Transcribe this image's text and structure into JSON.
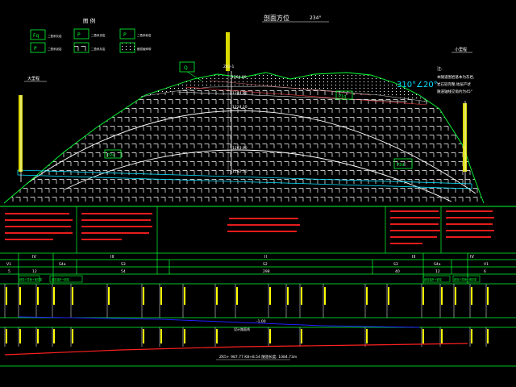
{
  "header": {
    "title": "剖面方位",
    "bearing": "234°"
  },
  "legend": {
    "title": "图 例",
    "items": [
      {
        "code": "Fq",
        "label": "二叠系灰岩"
      },
      {
        "code": "P",
        "label": "二叠系页岩"
      },
      {
        "code": "P",
        "label": "二叠系砂岩"
      },
      {
        "code": "P",
        "label": "二叠系泥岩"
      },
      {
        "code": "",
        "label": "二叠系灰岩"
      },
      {
        "code": "",
        "label": "断层破碎带"
      }
    ]
  },
  "profile": {
    "left_portal_label": "大里程",
    "right_portal_label": "小里程",
    "peak_code": "Q",
    "borehole_id": "ZK3-1",
    "elevations": [
      "1264.80",
      "1244.80",
      "1224.20",
      "1203.90",
      "1182.50"
    ],
    "dip_annotation": "310°∠20°",
    "notes_title": "注:",
    "notes": [
      "本隧道围岩基本为灰岩,",
      "岩石较完整,地层产状",
      "隧道轴线交角约为45°"
    ],
    "unit_codes": [
      "P2s",
      "P1q",
      "P2d"
    ]
  },
  "annotation_rows": {
    "grades": [
      "IV",
      "III",
      "II",
      "III",
      "IV"
    ],
    "support_types": [
      "V1",
      "S4a",
      "S3",
      "S2",
      "S3",
      "S4a",
      "V1"
    ],
    "lengths": [
      "5",
      "12",
      "54",
      "298",
      "40",
      "12",
      "6"
    ],
    "construction_method": [
      "超前小导管+钢拱架",
      "超前锚杆+钢架",
      "超前锚杆+钢架",
      "超前小导管+钢拱架"
    ],
    "gradient_label": "-1.00",
    "design_line_label": "设计路面线",
    "footer": "ZK5+ 987.77  K8+8.54  隧道长度: 1084.73m"
  },
  "colors": {
    "terrain": "#00ff33",
    "grid": "#ffffff",
    "rows": "#00ff33",
    "text_red": "#ff2020",
    "text_yellow": "#ffff00",
    "line_blue": "#2020ff",
    "line_red": "#ff2020"
  }
}
